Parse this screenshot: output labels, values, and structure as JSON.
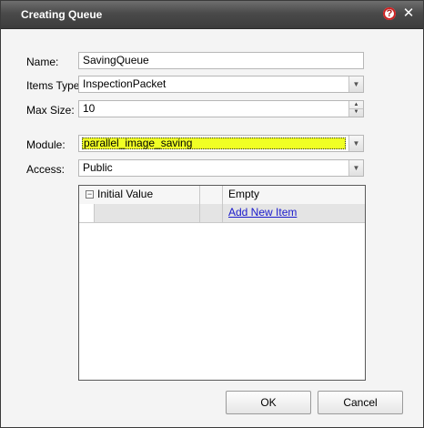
{
  "dialog": {
    "title": "Creating Queue",
    "icons": {
      "help": "help-icon",
      "close": "close-icon"
    }
  },
  "form": {
    "name": {
      "label": "Name:",
      "value": "SavingQueue"
    },
    "items_type": {
      "label": "Items Type:",
      "value": "InspectionPacket"
    },
    "max_size": {
      "label": "Max Size:",
      "value": "10"
    },
    "module": {
      "label": "Module:",
      "value": "parallel_image_saving",
      "highlight_color": "#f0ff24"
    },
    "access": {
      "label": "Access:",
      "value": "Public"
    }
  },
  "grid": {
    "header": {
      "col1": "Initial Value",
      "col3": "Empty"
    },
    "rows": [
      {
        "action": "Add New Item"
      }
    ]
  },
  "buttons": {
    "ok": "OK",
    "cancel": "Cancel"
  }
}
